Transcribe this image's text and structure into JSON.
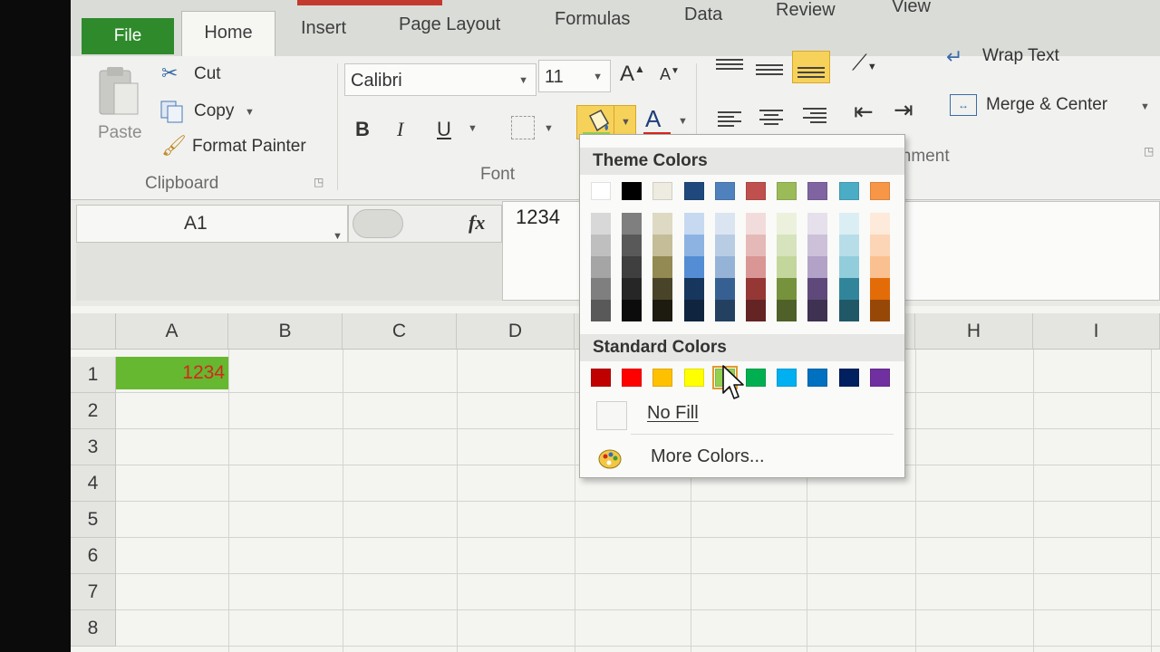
{
  "tabs": {
    "file": "File",
    "home": "Home",
    "insert": "Insert",
    "page_layout": "Page Layout",
    "formulas": "Formulas",
    "data": "Data",
    "review": "Review",
    "view": "View"
  },
  "clipboard": {
    "paste": "Paste",
    "cut": "Cut",
    "copy": "Copy",
    "format_painter": "Format Painter",
    "group_label": "Clipboard"
  },
  "font": {
    "name": "Calibri",
    "size": "11",
    "bold": "B",
    "italic": "I",
    "underline": "U",
    "font_color_letter": "A",
    "group_label": "Font"
  },
  "alignment": {
    "wrap_text": "Wrap Text",
    "merge_center": "Merge & Center",
    "group_label": "ignment"
  },
  "formula_bar": {
    "name_box": "A1",
    "fx": "fx",
    "value": "1234"
  },
  "sheet": {
    "columns": [
      "A",
      "B",
      "C",
      "D",
      "H",
      "I"
    ],
    "rows": [
      "1",
      "2",
      "3",
      "4",
      "5",
      "6",
      "7",
      "8"
    ],
    "a1_value": "1234",
    "a1_fill": "#65b82f",
    "a1_font_color": "#d6261e"
  },
  "fill_menu": {
    "theme_title": "Theme Colors",
    "standard_title": "Standard Colors",
    "no_fill": "No Fill",
    "more_colors": "More Colors...",
    "theme_colors": [
      "#ffffff",
      "#000000",
      "#eeece1",
      "#1f497d",
      "#4f81bd",
      "#c0504d",
      "#9bbb59",
      "#8064a2",
      "#4bacc6",
      "#f79646"
    ],
    "theme_shades": [
      [
        "#d8d8d8",
        "#bfbfbf",
        "#a5a5a5",
        "#7f7f7f",
        "#595959"
      ],
      [
        "#7f7f7f",
        "#595959",
        "#3f3f3f",
        "#262626",
        "#0c0c0c"
      ],
      [
        "#ddd9c3",
        "#c4bd97",
        "#938953",
        "#494429",
        "#1d1b10"
      ],
      [
        "#c6d9f0",
        "#8db3e2",
        "#548dd4",
        "#17365d",
        "#0f243e"
      ],
      [
        "#dbe5f1",
        "#b8cce4",
        "#95b3d7",
        "#366092",
        "#244061"
      ],
      [
        "#f2dcdb",
        "#e5b9b7",
        "#d99694",
        "#953734",
        "#632423"
      ],
      [
        "#ebf1dd",
        "#d7e3bc",
        "#c3d69b",
        "#76923c",
        "#4f6128"
      ],
      [
        "#e5e0ec",
        "#ccc1d9",
        "#b2a2c7",
        "#5f497a",
        "#3f3151"
      ],
      [
        "#dbeef3",
        "#b7dde8",
        "#92cddc",
        "#31859b",
        "#205867"
      ],
      [
        "#fdeada",
        "#fbd5b5",
        "#fac08f",
        "#e36c09",
        "#974806"
      ]
    ],
    "standard_colors": [
      "#c00000",
      "#ff0000",
      "#ffc000",
      "#ffff00",
      "#92d050",
      "#00b050",
      "#00b0f0",
      "#0070c0",
      "#002060",
      "#7030a0"
    ],
    "selected_standard_index": 4
  }
}
